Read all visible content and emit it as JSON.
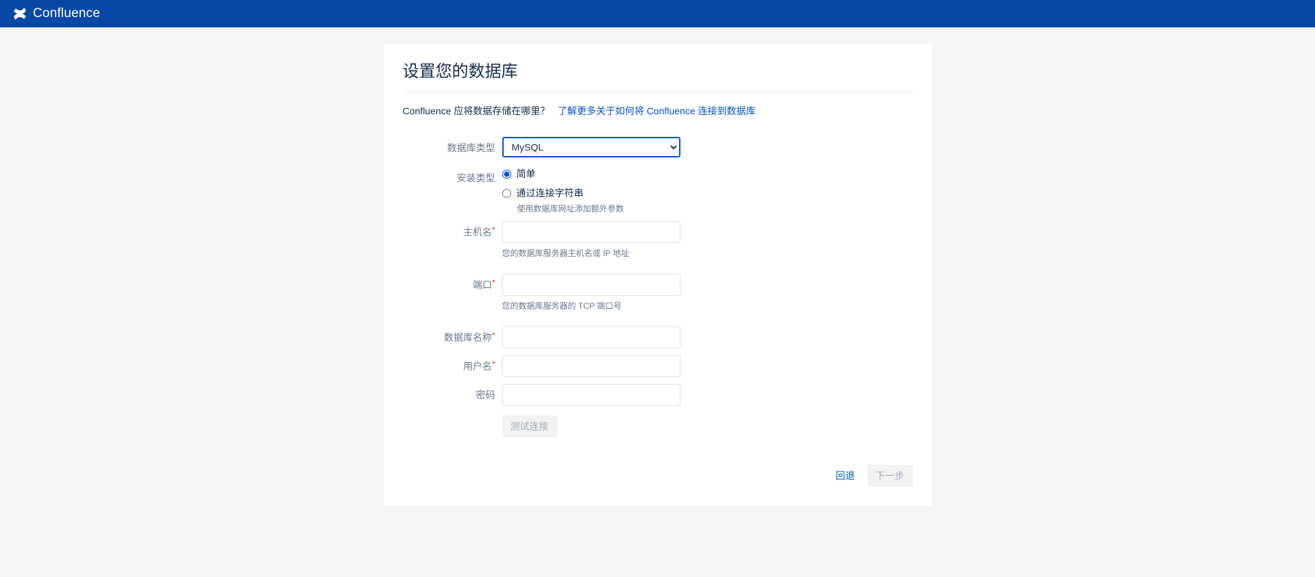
{
  "header": {
    "brand": "Confluence"
  },
  "page": {
    "title": "设置您的数据库",
    "lead_text": "Confluence 应将数据存储在哪里？",
    "lead_link": "了解更多关于如何将 Confluence 连接到数据库"
  },
  "form": {
    "db_type": {
      "label": "数据库类型",
      "value": "MySQL"
    },
    "install_type": {
      "label": "安装类型",
      "opt_simple": "简单",
      "opt_conn_string": "通过连接字符串",
      "conn_hint": "使用数据库网址添加额外参数"
    },
    "host": {
      "label": "主机名",
      "hint": "您的数据库服务器主机名或 IP 地址"
    },
    "port": {
      "label": "端口",
      "hint": "您的数据库服务器的 TCP 端口号"
    },
    "db_name": {
      "label": "数据库名称"
    },
    "user": {
      "label": "用户名"
    },
    "password": {
      "label": "密码"
    },
    "test_btn": "测试连接"
  },
  "footer": {
    "back": "回退",
    "next": "下一步"
  }
}
